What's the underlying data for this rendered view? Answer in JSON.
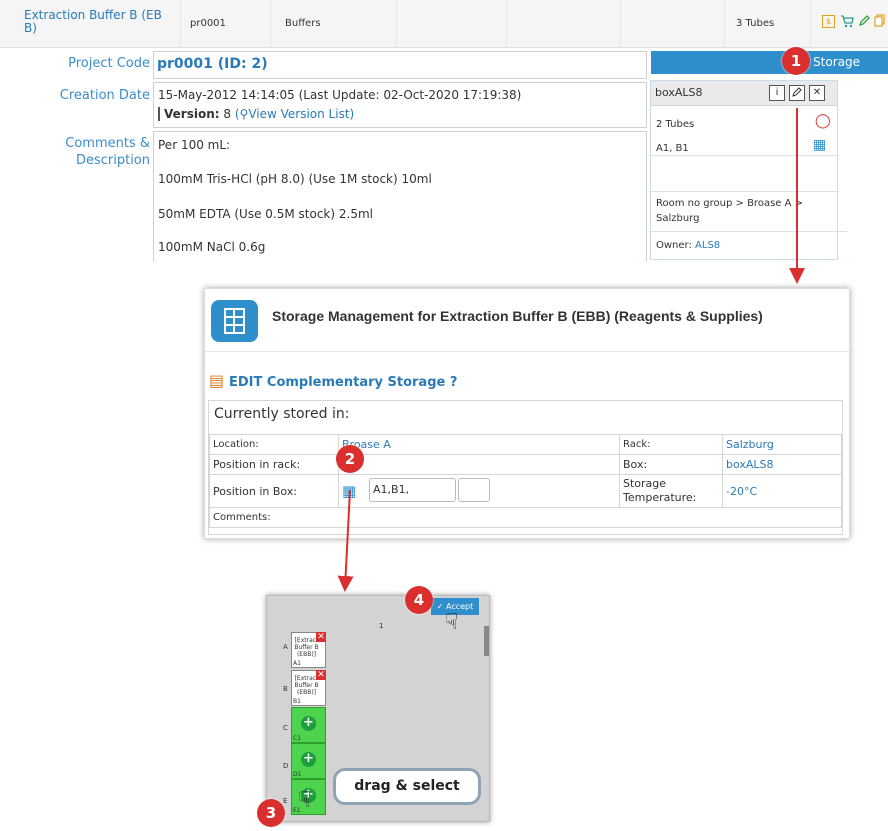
{
  "top_row": {
    "name": "Extraction Buffer B (EB B)",
    "project": "pr0001",
    "category": "Buffers",
    "amount": "3 Tubes"
  },
  "detail": {
    "project_code_label": "Project Code",
    "project_code_value": "pr0001 (ID: 2)",
    "creation_label": "Creation Date",
    "creation_value": "15-May-2012 14:14:05 (Last Update: 02-Oct-2020 17:19:38)",
    "version_label": "Version:",
    "version_value": "8",
    "version_open": "(",
    "version_link": "View Version List",
    "version_close": ")",
    "comments_label": "Comments & Description",
    "comment_lines": [
      "Per 100 mL:",
      "100mM Tris-HCl (pH 8.0) (Use 1M stock) 10ml",
      "50mM EDTA (Use 0.5M stock) 2.5ml",
      "100mM NaCl 0.6g"
    ]
  },
  "storage_panel": {
    "bar_label": "Storage",
    "box_name": "boxALS8",
    "info_btn": "i",
    "close_btn": "✕",
    "tubes": "2 Tubes",
    "positions": "A1, B1",
    "location": "Room no group > Broase A > Salzburg",
    "owner_label": "Owner:",
    "owner_value": "ALS8"
  },
  "dialog": {
    "title": "Storage Management for Extraction Buffer B (EBB) (Reagents & Supplies)",
    "edit_link": "EDIT Complementary Storage ?",
    "currently_stored": "Currently stored in:",
    "location_label": "Location:",
    "location_value": "Broase A",
    "rack_label": "Rack:",
    "rack_value": "Salzburg",
    "pos_rack_label": "Position in rack:",
    "box_label": "Box:",
    "box_value": "boxALS8",
    "pos_box_label": "Position in Box:",
    "pos_box_value": "A1,B1,",
    "temp_label": "Storage Temperature:",
    "temp_value": "-20°C",
    "comments_label": "Comments:"
  },
  "box_grid": {
    "column_header": "1",
    "accept_label": "✓ Accept",
    "rows": [
      {
        "row": "A",
        "state": "occupied",
        "text": "[Extract Buffer B (EBB)]",
        "pos": "A1",
        "num": "1"
      },
      {
        "row": "B",
        "state": "occupied",
        "text": "[Extract Buffer B (EBB)]",
        "pos": "B1",
        "num": "2"
      },
      {
        "row": "C",
        "state": "free",
        "text": "",
        "pos": "C1",
        "num": "3"
      },
      {
        "row": "D",
        "state": "free",
        "text": "",
        "pos": "D1",
        "num": "4"
      },
      {
        "row": "E",
        "state": "free",
        "text": "",
        "pos": "E1",
        "num": "5"
      }
    ]
  },
  "annotations": {
    "callout": "drag & select",
    "badge1": "1",
    "badge2": "2",
    "badge3": "3",
    "badge4": "4"
  },
  "colors": {
    "accent": "#2f8fcc",
    "badge": "#d9302f",
    "free_slot": "#4ed34e"
  }
}
